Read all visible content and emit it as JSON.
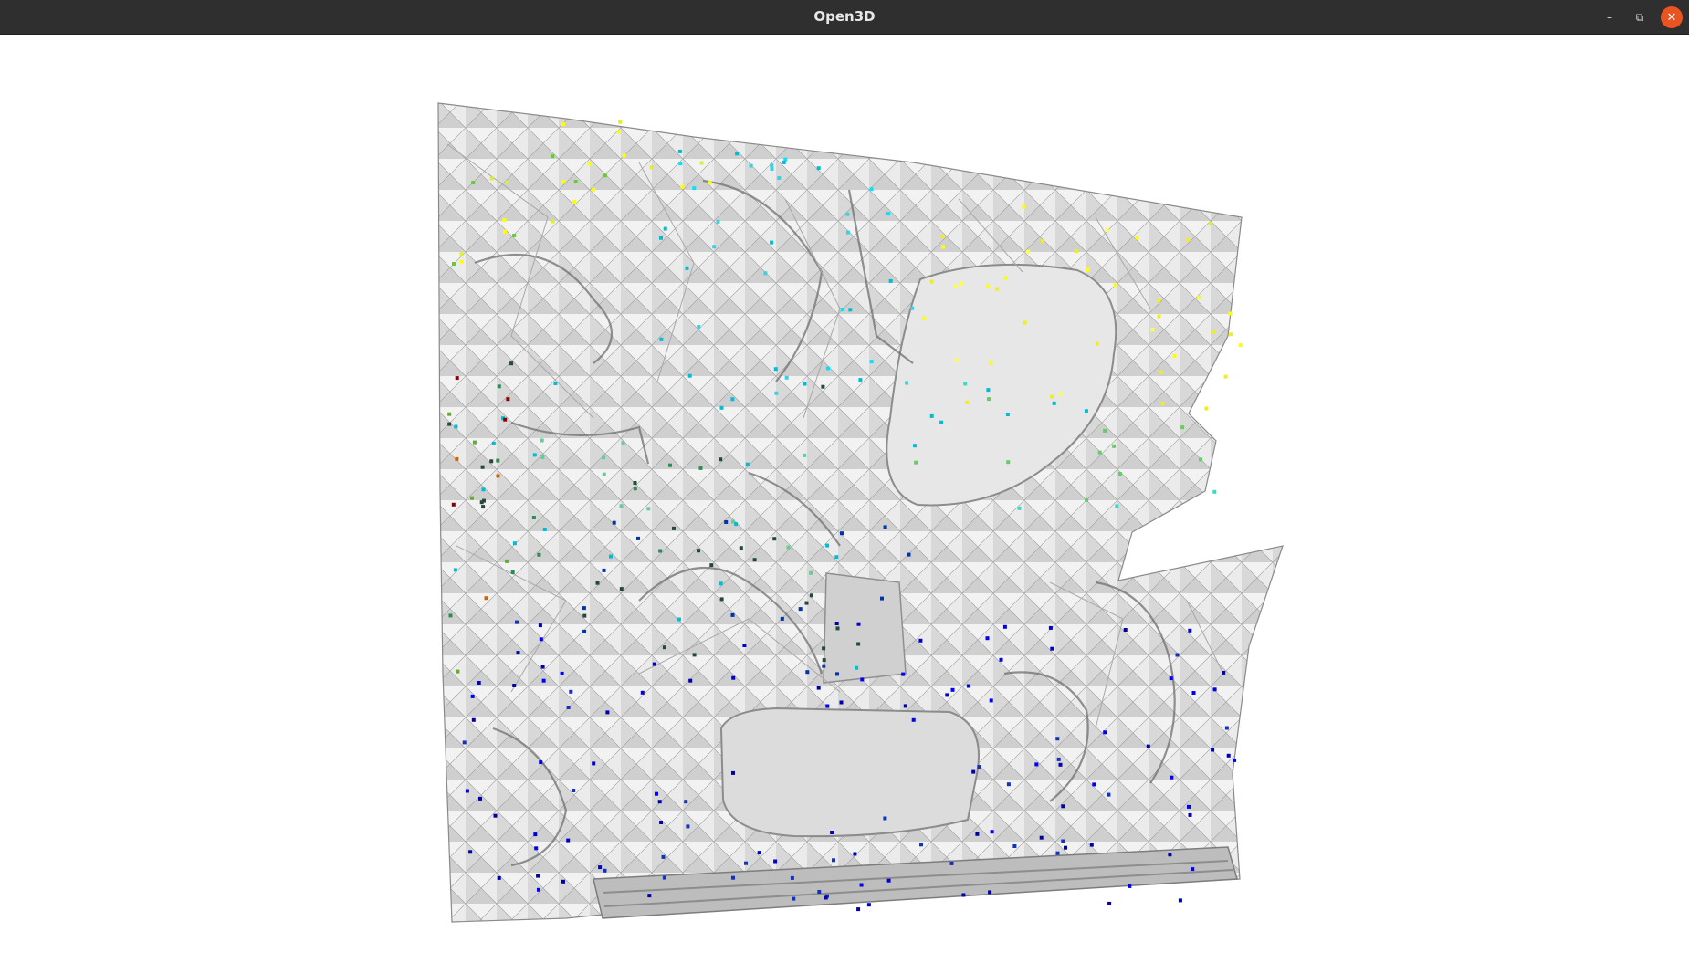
{
  "window": {
    "title": "Open3D",
    "controls": {
      "minimize_icon": "minimize-icon",
      "maximize_icon": "restore-icon",
      "close_icon": "close-icon",
      "close_color": "#e95420"
    }
  },
  "viewport": {
    "background": "#ffffff",
    "content": "mesh-with-colored-points",
    "mesh_color": "#d9d9d9",
    "point_colors": [
      "#0000aa",
      "#00bcd4",
      "#00e5ff",
      "#ffff00",
      "#66cc33",
      "#224a3a",
      "#8b0000"
    ]
  }
}
